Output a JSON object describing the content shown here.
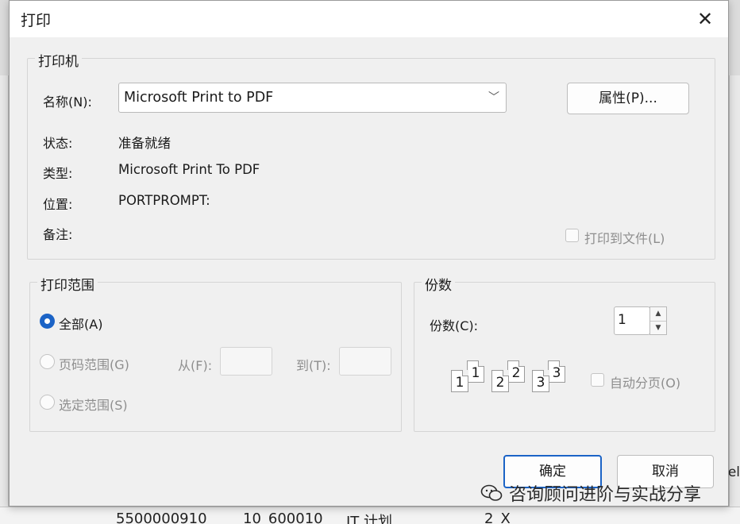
{
  "dialog": {
    "title": "打印"
  },
  "printer": {
    "group_label": "打印机",
    "name_label": "名称(N):",
    "name_value": "Microsoft Print to PDF",
    "properties_button": "属性(P)...",
    "status_label": "状态:",
    "status_value": "准备就绪",
    "type_label": "类型:",
    "type_value": "Microsoft Print To PDF",
    "location_label": "位置:",
    "location_value": "PORTPROMPT:",
    "comment_label": "备注:",
    "print_to_file_label": "打印到文件(L)"
  },
  "range": {
    "group_label": "打印范围",
    "all_label": "全部(A)",
    "pages_label": "页码范围(G)",
    "from_label": "从(F):",
    "to_label": "到(T):",
    "selection_label": "选定范围(S)"
  },
  "copies": {
    "group_label": "份数",
    "copies_label": "份数(C):",
    "copies_value": "1",
    "collate_label": "自动分页(O)",
    "pages": [
      "1",
      "1",
      "2",
      "2",
      "3",
      "3"
    ]
  },
  "buttons": {
    "ok": "确定",
    "cancel": "取消"
  },
  "background": {
    "cells": [
      "5500000910",
      "10_600010",
      "IT 计划",
      "2_X"
    ],
    "edge_text": "el"
  },
  "watermark": {
    "text": "咨询顾问进阶与实战分享"
  }
}
